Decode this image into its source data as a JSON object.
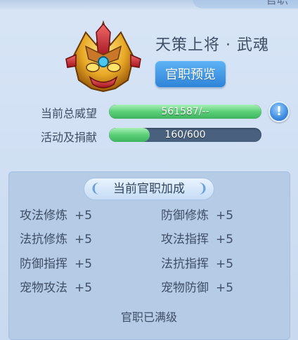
{
  "window": {
    "title": "官职"
  },
  "rank": {
    "name": "天策上将 · 武魂",
    "preview_button": "官职预览"
  },
  "stats": [
    {
      "label": "当前总威望",
      "value_text": "561587/--",
      "fill": 1.0
    },
    {
      "label": "活动及捐献",
      "value_text": "160/600",
      "fill": 0.267
    }
  ],
  "info_icon": "!",
  "bonus_panel": {
    "title": "当前官职加成",
    "items": [
      {
        "name": "攻法修炼",
        "value": "+5"
      },
      {
        "name": "防御修炼",
        "value": "+5"
      },
      {
        "name": "法抗修炼",
        "value": "+5"
      },
      {
        "name": "攻法指挥",
        "value": "+5"
      },
      {
        "name": "防御指挥",
        "value": "+5"
      },
      {
        "name": "法抗指挥",
        "value": "+5"
      },
      {
        "name": "宠物攻法",
        "value": "+5"
      },
      {
        "name": "宠物防御",
        "value": "+5"
      }
    ],
    "footer": "官职已满级"
  },
  "colors": {
    "accent": "#2e84d8",
    "bar_fill": "#5bcf78",
    "bar_bg": "#49617f"
  }
}
